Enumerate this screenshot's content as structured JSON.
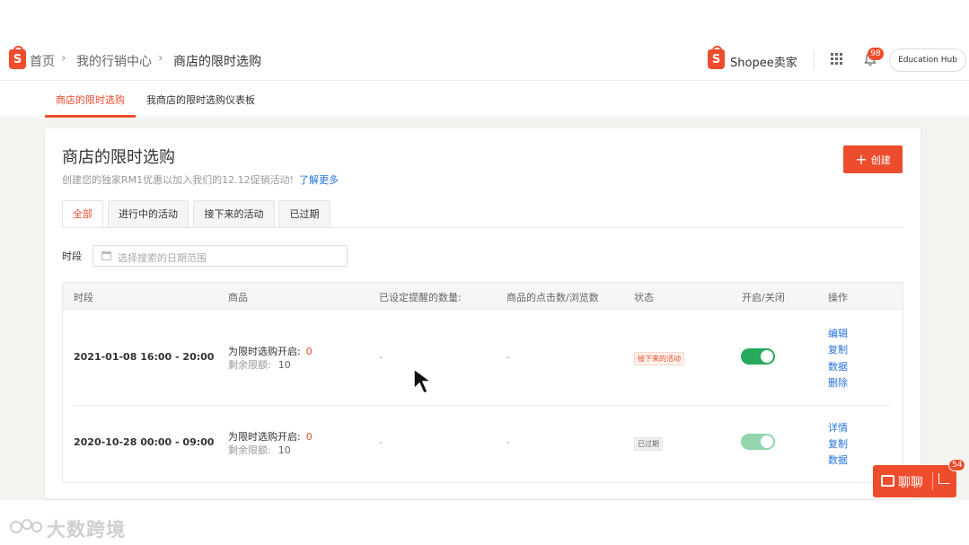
{
  "header": {
    "breadcrumb": {
      "home": "首页",
      "marketing": "我的行销中心",
      "current": "商店的限时选购"
    },
    "seller_brand": "Shopee卖家",
    "notifications_count": "98",
    "education_hub": "Education Hub"
  },
  "subnav": {
    "tabs": [
      {
        "label": "商店的限时选购",
        "active": true
      },
      {
        "label": "我商店的限时选购仪表板",
        "active": false
      }
    ]
  },
  "main": {
    "title": "商店的限时选购",
    "promo_text": "创建您的独家RM1优惠以加入我们的12.12促销活动!",
    "promo_link": "了解更多",
    "create_label": "创建",
    "filter_tabs": [
      {
        "label": "全部",
        "active": true
      },
      {
        "label": "进行中的活动",
        "active": false
      },
      {
        "label": "接下来的活动",
        "active": false
      },
      {
        "label": "已过期",
        "active": false
      }
    ],
    "period_label": "时段",
    "date_placeholder": "选择搜索的日期范围",
    "table": {
      "columns": [
        "时段",
        "商品",
        "已设定提醒的数量:",
        "商品的点击数/浏览数",
        "状态",
        "开启/关闭",
        "操作"
      ],
      "rows": [
        {
          "period": "2021-01-08 16:00 - 20:00",
          "enabled_label": "为限时选购开启:",
          "enabled_count": "0",
          "remaining_label": "剩余限额:",
          "remaining_count": "10",
          "reminders": "-",
          "clicks": "-",
          "status": "接下来的活动",
          "toggle_on": true,
          "actions": [
            "编辑",
            "复制",
            "数据",
            "删除"
          ]
        },
        {
          "period": "2020-10-28 00:00 - 09:00",
          "enabled_label": "为限时选购开启:",
          "enabled_count": "0",
          "remaining_label": "剩余限额:",
          "remaining_count": "10",
          "reminders": "-",
          "clicks": "-",
          "status": "已过期",
          "toggle_on": true,
          "actions": [
            "详情",
            "复制",
            "数据"
          ]
        }
      ]
    }
  },
  "chat": {
    "label": "聊聊",
    "badge": "54"
  },
  "watermark": {
    "text": "大数跨境"
  },
  "colors": {
    "brand": "#ee4d2d",
    "link": "#2673dd",
    "toggle_on": "#26aa5b"
  }
}
